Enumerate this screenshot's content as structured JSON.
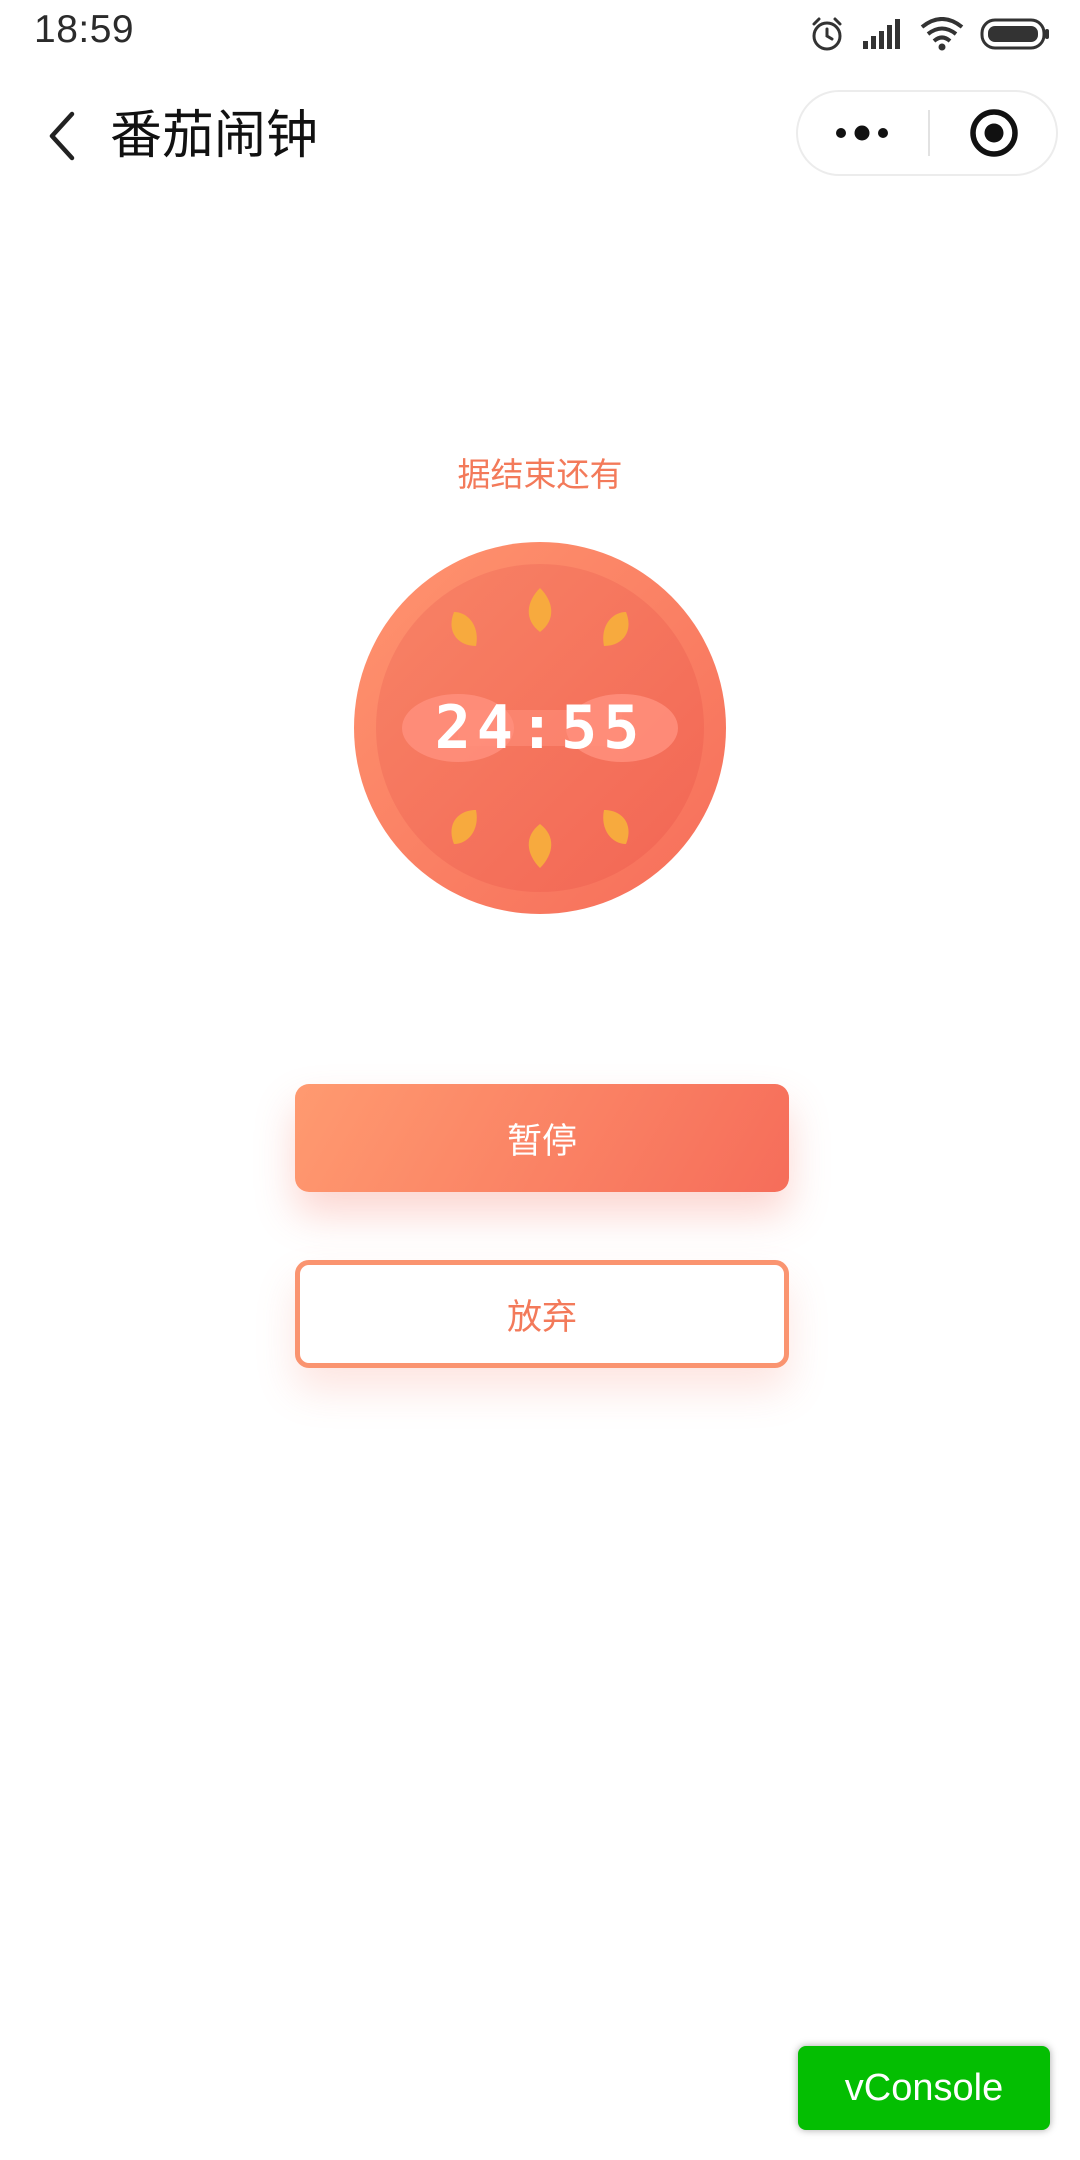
{
  "status_bar": {
    "time": "18:59",
    "icons": [
      "alarm-icon",
      "signal-icon",
      "wifi-icon",
      "battery-icon"
    ]
  },
  "nav": {
    "title": "番茄闹钟",
    "back_icon": "chevron-left-icon",
    "more_icon": "more-dots-icon",
    "close_icon": "target-circle-icon"
  },
  "timer": {
    "label": "据结束还有",
    "time": "24:55"
  },
  "buttons": {
    "pause": "暂停",
    "abandon": "放弃"
  },
  "vconsole": {
    "label": "vConsole"
  },
  "colors": {
    "accent": "#f37a5a",
    "tomato_outer": "#fb8a6c",
    "tomato_inner": "#f46e5b",
    "seed": "#f7aa3e",
    "vconsole_green": "#04be02"
  }
}
